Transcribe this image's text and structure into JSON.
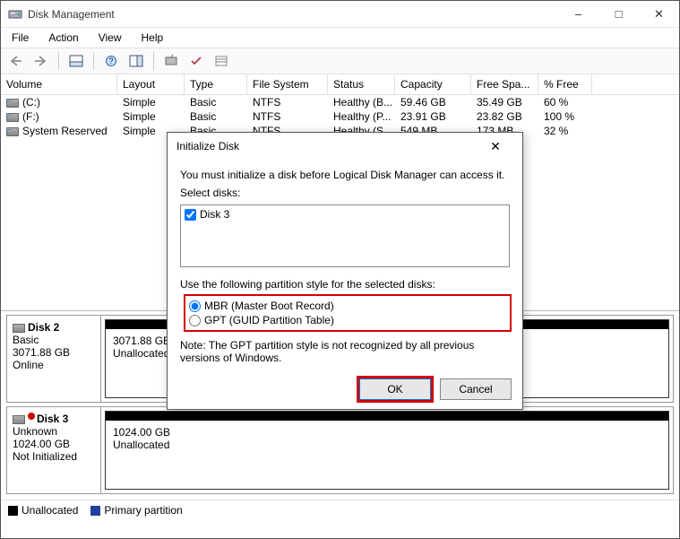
{
  "title": "Disk Management",
  "menu": {
    "file": "File",
    "action": "Action",
    "view": "View",
    "help": "Help"
  },
  "grid": {
    "headers": {
      "volume": "Volume",
      "layout": "Layout",
      "type": "Type",
      "fs": "File System",
      "status": "Status",
      "capacity": "Capacity",
      "free": "Free Spa...",
      "pct": "% Free"
    },
    "rows": [
      {
        "volume": "(C:)",
        "layout": "Simple",
        "type": "Basic",
        "fs": "NTFS",
        "status": "Healthy (B...",
        "capacity": "59.46 GB",
        "free": "35.49 GB",
        "pct": "60 %"
      },
      {
        "volume": "(F:)",
        "layout": "Simple",
        "type": "Basic",
        "fs": "NTFS",
        "status": "Healthy (P...",
        "capacity": "23.91 GB",
        "free": "23.82 GB",
        "pct": "100 %"
      },
      {
        "volume": "System Reserved",
        "layout": "Simple",
        "type": "Basic",
        "fs": "NTFS",
        "status": "Healthy (S...",
        "capacity": "549 MB",
        "free": "173 MB",
        "pct": "32 %"
      }
    ]
  },
  "disks": [
    {
      "name": "Disk 2",
      "type": "Basic",
      "size": "3071.88 GB",
      "status": "Online",
      "part_size": "3071.88 GB",
      "part_status": "Unallocated"
    },
    {
      "name": "Disk 3",
      "type": "Unknown",
      "size": "1024.00 GB",
      "status": "Not Initialized",
      "part_size": "1024.00 GB",
      "part_status": "Unallocated",
      "uninit": true
    }
  ],
  "legend": {
    "unallocated": "Unallocated",
    "primary": "Primary partition"
  },
  "dialog": {
    "title": "Initialize Disk",
    "msg": "You must initialize a disk before Logical Disk Manager can access it.",
    "select_label": "Select disks:",
    "disks": [
      {
        "label": "Disk 3",
        "checked": true
      }
    ],
    "style_label": "Use the following partition style for the selected disks:",
    "options": [
      {
        "label": "MBR (Master Boot Record)",
        "selected": true
      },
      {
        "label": "GPT (GUID Partition Table)",
        "selected": false
      }
    ],
    "note": "Note: The GPT partition style is not recognized by all previous versions of Windows.",
    "ok": "OK",
    "cancel": "Cancel"
  }
}
